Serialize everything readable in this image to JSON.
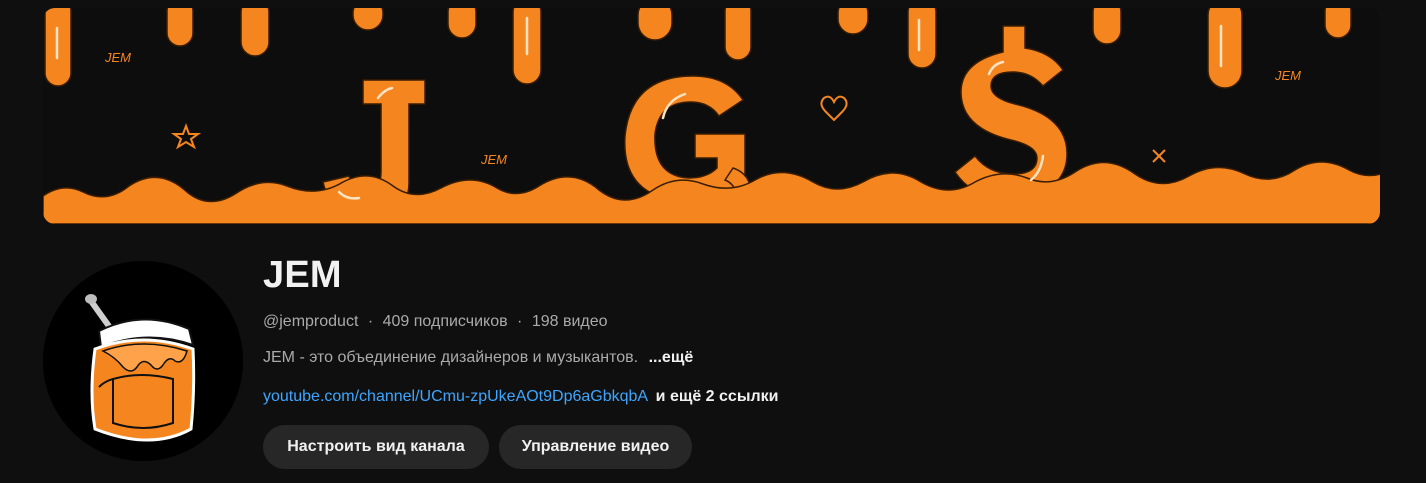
{
  "channel": {
    "name": "JEM",
    "handle": "@jemproduct",
    "subscribers": "409 подписчиков",
    "videos": "198 видео",
    "separator": "·",
    "description": "JEM - это объединение дизайнеров и музыкантов.",
    "description_more": "...ещё",
    "link": "youtube.com/channel/UCmu-zpUkeAOt9Dp6aGbkqbA",
    "more_links": "и ещё 2 ссылки"
  },
  "banner": {
    "watermark_text": "JEM",
    "letters": [
      "J",
      "G",
      "$"
    ]
  },
  "buttons": {
    "customize": "Настроить вид канала",
    "manage": "Управление видео"
  },
  "colors": {
    "background": "#0f0f0f",
    "accent_orange": "#f5861f",
    "link_blue": "#3ea6ff",
    "button_bg": "#272727"
  }
}
